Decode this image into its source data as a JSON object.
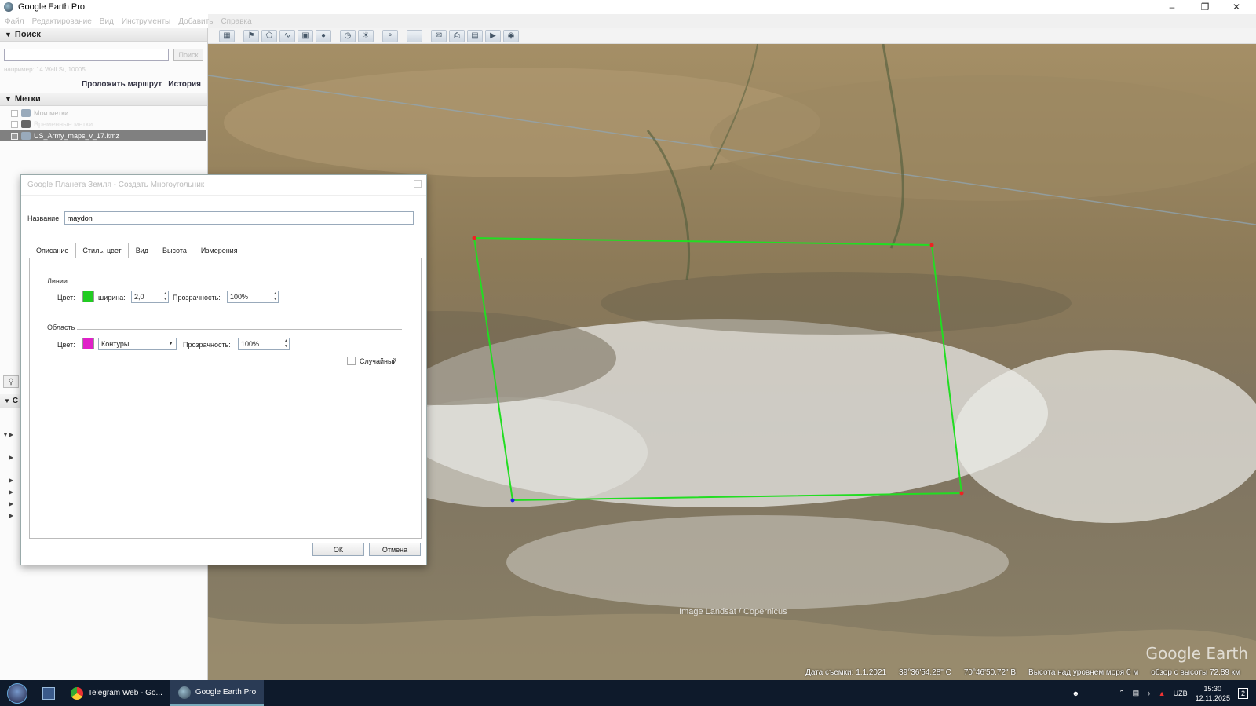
{
  "app": {
    "title": "Google Earth Pro"
  },
  "menu": [
    "Файл",
    "Редактирование",
    "Вид",
    "Инструменты",
    "Добавить",
    "Справка"
  ],
  "search": {
    "section_title": "Поиск",
    "placeholder": "",
    "button_label": "Поиск",
    "hint": "например: 14 Wall St, 10005",
    "route_link": "Проложить маршрут",
    "history_link": "История"
  },
  "places": {
    "section_title": "Метки",
    "items": [
      {
        "label": "Мои метки",
        "selected": false
      },
      {
        "label": "Временные метки",
        "selected": false
      },
      {
        "label": "US_Army_maps_v_17.kmz",
        "selected": true
      }
    ]
  },
  "layers": {
    "section_title": "С"
  },
  "dialog": {
    "title": "Google Планета Земля - Создать Многоугольник",
    "name_label": "Название:",
    "name_value": "maydon",
    "tabs": [
      "Описание",
      "Стиль, цвет",
      "Вид",
      "Высота",
      "Измерения"
    ],
    "active_tab": "Стиль, цвет",
    "lines": {
      "group_label": "Линии",
      "color_label": "Цвет:",
      "color": "#22cc22",
      "width_label": "ширина:",
      "width_value": "2,0",
      "opacity_label": "Прозрачность:",
      "opacity_value": "100%"
    },
    "area": {
      "group_label": "Область",
      "color_label": "Цвет:",
      "color": "#e020c8",
      "fill_mode": "Контуры",
      "opacity_label": "Прозрачность:",
      "opacity_value": "100%"
    },
    "random_label": "Случайный",
    "ok_label": "ОК",
    "cancel_label": "Отмена"
  },
  "map": {
    "attribution": "Image Landsat / Copernicus",
    "status": {
      "date": "Дата съемки: 1.1.2021",
      "lat": "39°36'54.28\" С",
      "lon": "70°46'50.72\" В",
      "elevation": "Высота над уровнем моря  0 м",
      "eye_alt": "обзор с высоты  72.89 км"
    },
    "polygon_color": "#22dd22"
  },
  "taskbar": {
    "apps": [
      {
        "label": "Telegram Web - Go...",
        "icon": "chrome-icon",
        "active": false
      },
      {
        "label": "Google Earth Pro",
        "icon": "google-earth-icon",
        "active": true
      }
    ],
    "lang": "UZB",
    "time": "15:30",
    "date": "12.11.2025",
    "notifications": "2"
  }
}
